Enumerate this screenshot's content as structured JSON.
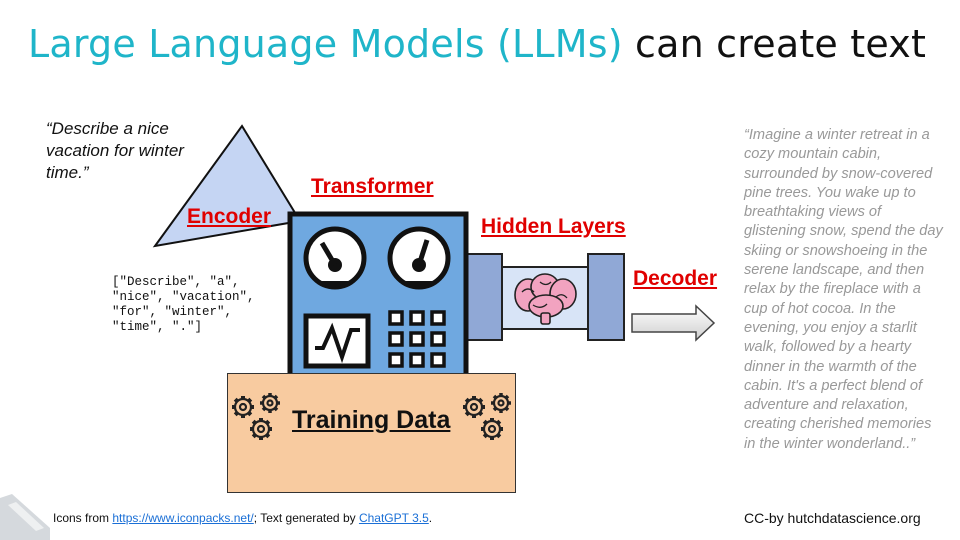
{
  "title": {
    "part1": "Large Language Models (LLMs)",
    "part2": " can create text",
    "accent_color": "#1fb5c9"
  },
  "prompt": "“Describe a nice vacation for winter time.”",
  "tokens": "[\"Describe\", \"a\",\n\"nice\", \"vacation\",\n\"for\", \"winter\",\n\"time\", \".\"]",
  "labels": {
    "encoder": "Encoder",
    "transformer": "Transformer",
    "hidden_layers": "Hidden Layers",
    "decoder": "Decoder",
    "training_data": "Training Data",
    "color": "#e00000"
  },
  "output_text": "“Imagine a winter retreat in a cozy mountain cabin, surrounded by snow-covered pine trees. You wake up to breathtaking views of glistening snow, spend the day skiing or snowshoeing in the serene landscape, and then relax by the fireplace with a cup of hot cocoa. In the evening, you enjoy a starlit walk, followed by a hearty dinner in the warmth of the cabin. It's a perfect blend of adventure and relaxation, creating cherished memories in the winter wonderland..”",
  "footer": {
    "prefix": "Icons from ",
    "link1": "https://www.iconpacks.net/",
    "middle": "; Text generated by ",
    "link2": "ChatGPT 3.5",
    "suffix": "."
  },
  "license": "CC-by hutchdatascience.org",
  "icons": [
    "encoder-triangle",
    "robot-transformer",
    "brain-icon",
    "hidden-layer-pipe",
    "decoder-arrow-icon",
    "gear-icon",
    "logo-icon"
  ]
}
